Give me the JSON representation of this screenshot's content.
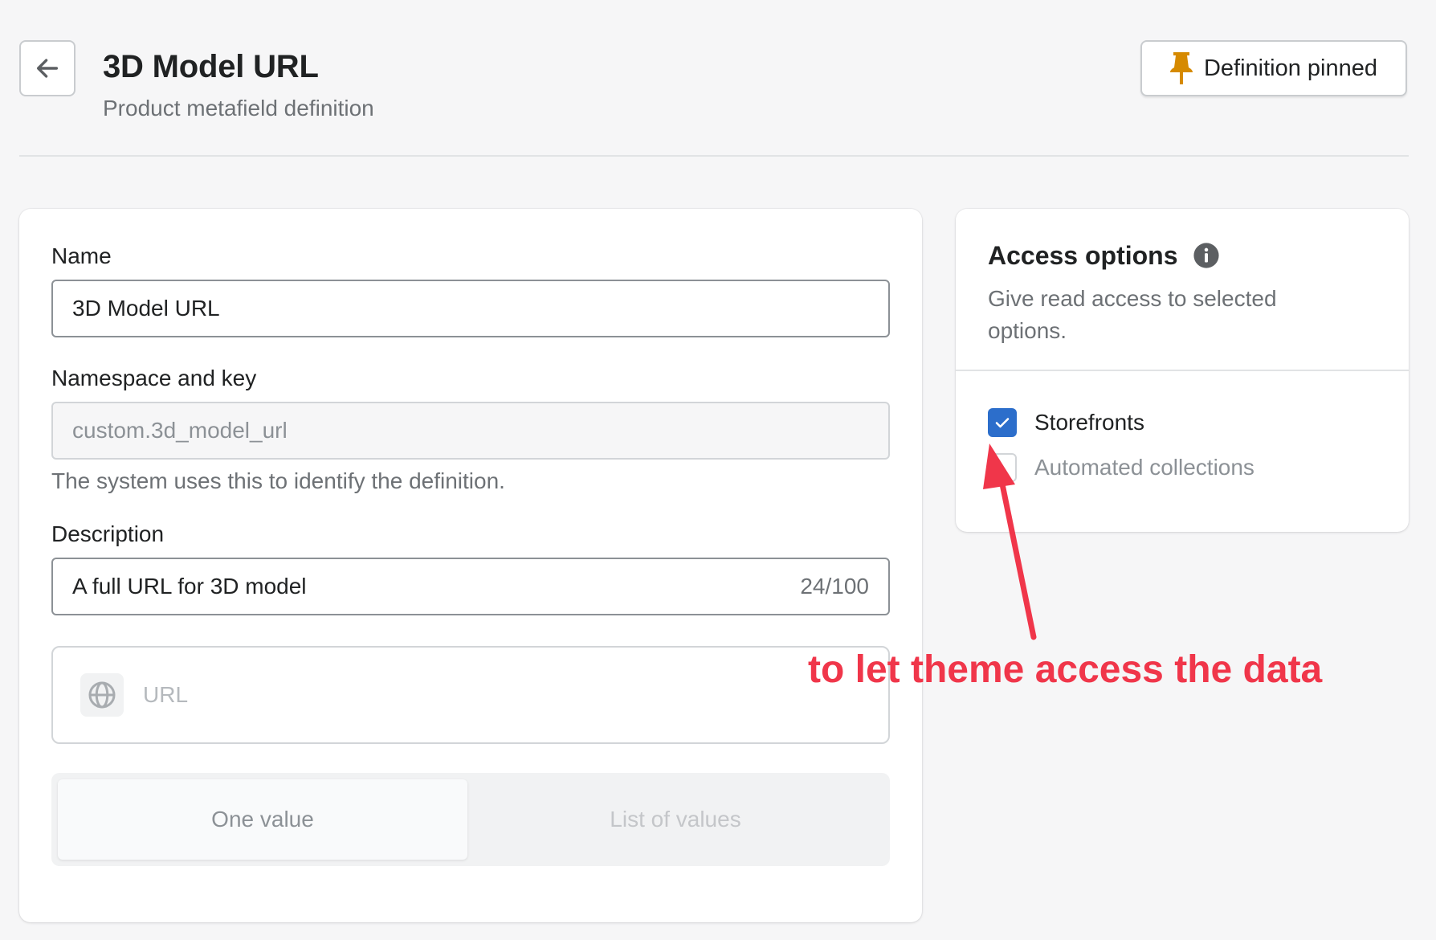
{
  "header": {
    "back_icon": "arrow-left-icon",
    "title": "3D Model URL",
    "subtitle": "Product metafield definition",
    "pin_button": {
      "icon": "pin-icon",
      "label": "Definition pinned",
      "icon_color": "#d68a00"
    }
  },
  "form": {
    "name": {
      "label": "Name",
      "value": "3D Model URL"
    },
    "namespace": {
      "label": "Namespace and key",
      "value": "custom.3d_model_url",
      "help": "The system uses this to identify the definition."
    },
    "description": {
      "label": "Description",
      "value": "A full URL for 3D model",
      "count": "24/100"
    },
    "type": {
      "icon": "globe-icon",
      "label": "URL"
    },
    "value_mode": {
      "options": [
        "One value",
        "List of values"
      ],
      "selected": "One value"
    }
  },
  "access": {
    "title": "Access options",
    "info_icon": "info-icon",
    "description": "Give read access to selected options.",
    "options": [
      {
        "label": "Storefronts",
        "checked": true
      },
      {
        "label": "Automated collections",
        "checked": false
      }
    ],
    "accent_color": "#2c6ecb"
  },
  "annotation": {
    "text": "to let theme access the data",
    "color": "#f0364a"
  }
}
